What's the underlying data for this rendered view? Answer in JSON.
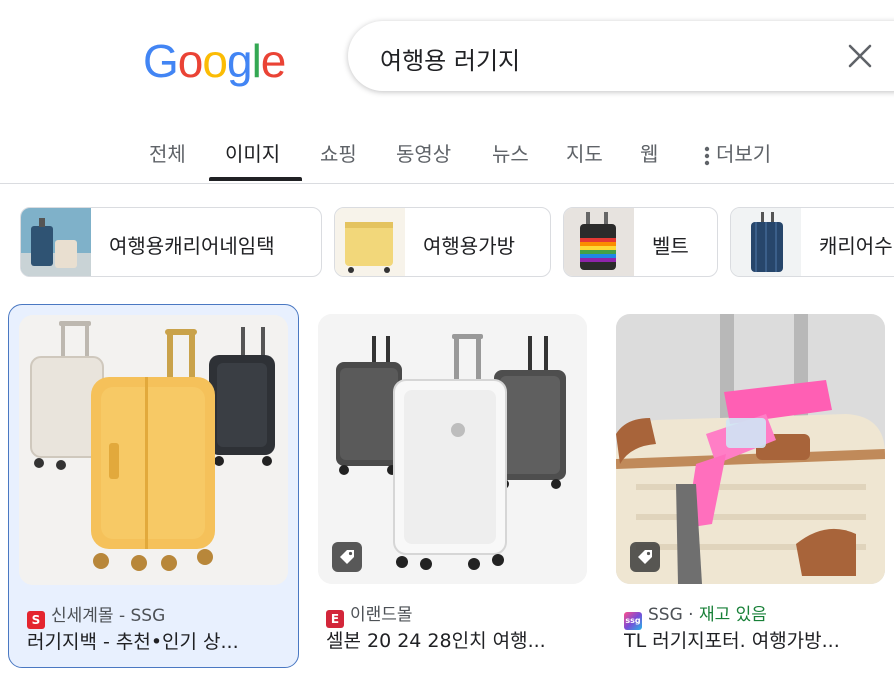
{
  "header": {
    "logo_letters": [
      "G",
      "o",
      "o",
      "g",
      "l",
      "e"
    ],
    "logo_colors": [
      "#4285F4",
      "#EA4335",
      "#FBBC05",
      "#4285F4",
      "#34A853",
      "#EA4335"
    ],
    "search_query": "여행용 러기지"
  },
  "tabs": [
    {
      "label": "전체"
    },
    {
      "label": "이미지",
      "active": true
    },
    {
      "label": "쇼핑"
    },
    {
      "label": "동영상"
    },
    {
      "label": "뉴스"
    },
    {
      "label": "지도"
    },
    {
      "label": "웹"
    },
    {
      "label": "더보기"
    }
  ],
  "chips": [
    {
      "label": "여행용캐리어네임택"
    },
    {
      "label": "여행용가방"
    },
    {
      "label": "벨트"
    },
    {
      "label": "캐리어수"
    }
  ],
  "results": [
    {
      "source": "신세계몰 - SSG",
      "title": "러기지백 - 추천•인기 상...",
      "favicon_color": "#e4252f",
      "favicon_letter": "S",
      "selected": true
    },
    {
      "source": "이랜드몰",
      "title": "셀본 20 24 28인치 여행...",
      "favicon_color": "#d3263a",
      "favicon_letter": "E",
      "has_tag": true
    },
    {
      "source": "SSG",
      "source_extra": "재고 있음",
      "title": "TL 러기지포터. 여행가방...",
      "favicon_color": "#7b4bd6",
      "favicon_letter": "ssg",
      "has_tag": true
    }
  ],
  "accent_color": "#1a73e8"
}
